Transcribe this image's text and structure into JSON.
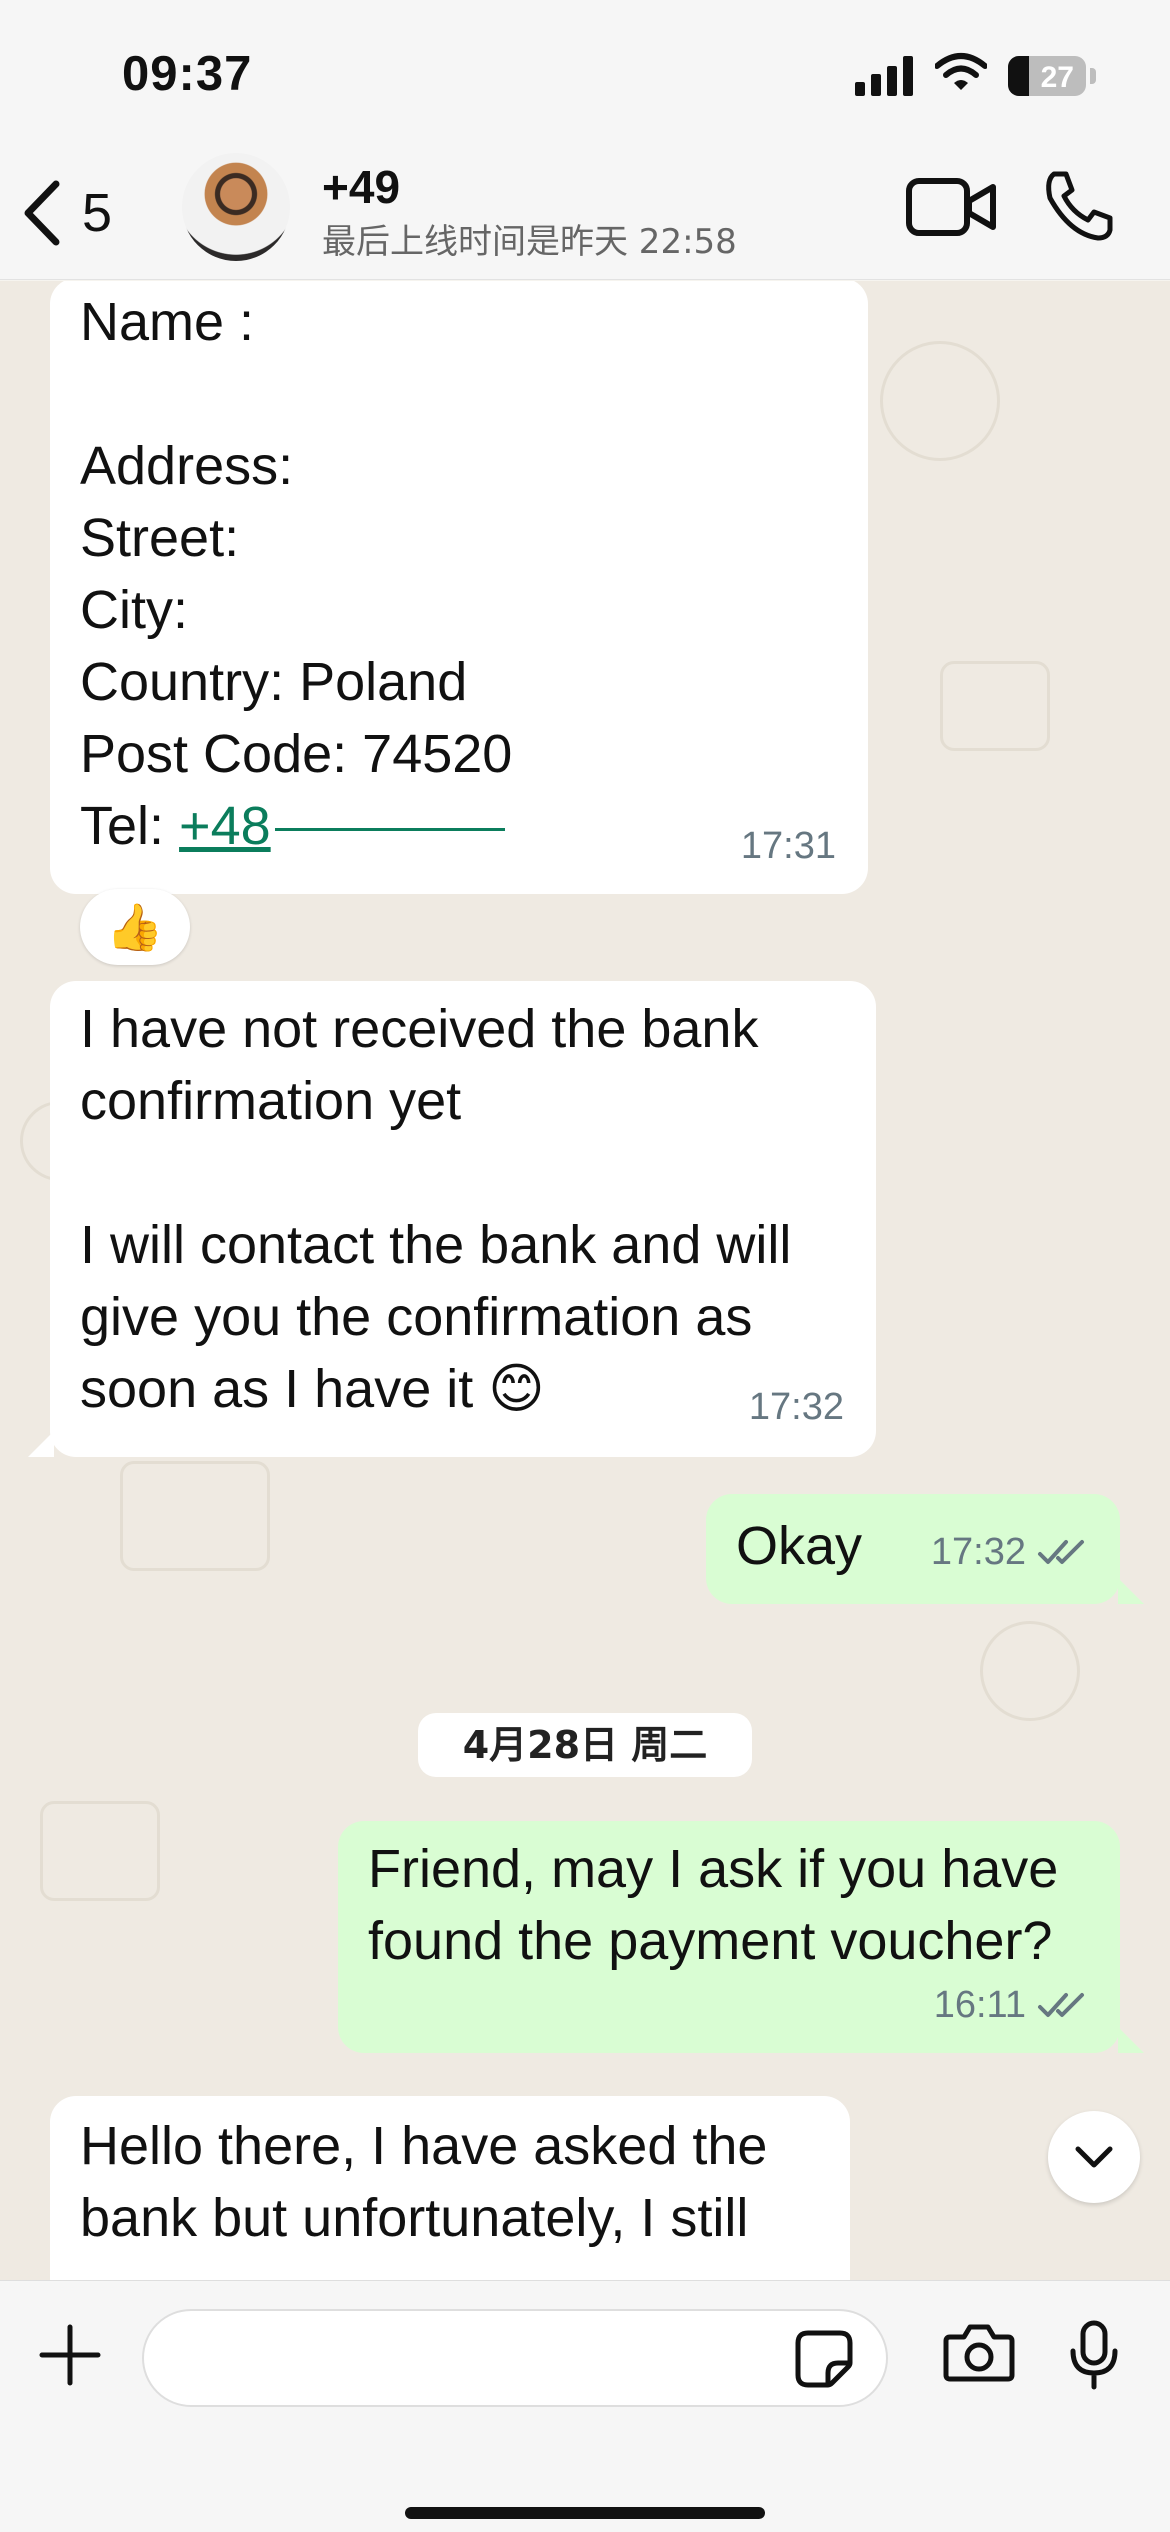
{
  "status_bar": {
    "time": "09:37",
    "battery": "27",
    "battery_level": 0.27
  },
  "header": {
    "back_count": "5",
    "contact_name": "+49",
    "last_seen": "最后上线时间是昨天 22:58"
  },
  "messages": {
    "m1": {
      "lines": [
        "Name :",
        "",
        "Address:",
        "Street:",
        "City:",
        "Country: Poland",
        "Post Code: 74520"
      ],
      "tel_label": "Tel: ",
      "tel_value": "+48",
      "time": "17:31",
      "reaction": "👍"
    },
    "m2": {
      "lines": [
        "I have not received the bank",
        "confirmation yet",
        "",
        "I will contact the bank and will",
        "give you the confirmation as",
        "soon as I have it 😊"
      ],
      "time": "17:32"
    },
    "m3": {
      "text": "Okay",
      "time": "17:32"
    },
    "date_separator": "4月28日 周二",
    "m4": {
      "lines": [
        "Friend, may I ask if you have",
        "found the payment voucher?"
      ],
      "time": "16:11"
    },
    "m5": {
      "lines": [
        "Hello there, I have asked the",
        "bank but unfortunately, I still"
      ]
    }
  },
  "composer": {
    "placeholder": "",
    "value": ""
  },
  "icons": {
    "back": "chevron-left-icon",
    "video": "video-camera-icon",
    "call": "phone-icon",
    "plus": "plus-icon",
    "sticker": "sticker-icon",
    "camera": "camera-icon",
    "mic": "microphone-icon",
    "read": "double-check-icon",
    "scroll": "chevron-down-icon"
  },
  "colors": {
    "outgoing": "#d9fdd3",
    "incoming": "#ffffff",
    "wallpaper": "#efeae2",
    "link": "#0b7d5c"
  }
}
